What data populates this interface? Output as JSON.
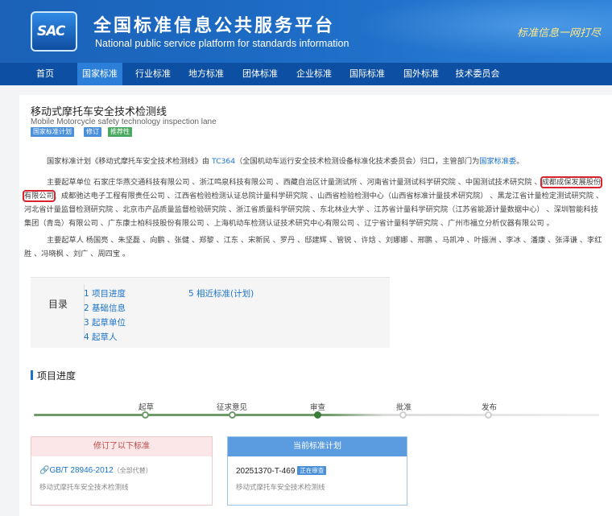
{
  "header": {
    "logo_text": "SAC",
    "title": "全国标准信息公共服务平台",
    "subtitle": "National public service platform  for standards information",
    "slogan": "标准信息一网打尽"
  },
  "nav": {
    "items": [
      "首页",
      "国家标准",
      "行业标准",
      "地方标准",
      "团体标准",
      "企业标准",
      "国际标准",
      "国外标准",
      "技术委员会"
    ],
    "active_index": 1
  },
  "standard": {
    "title": "移动式摩托车安全技术检测线",
    "title_en": "Mobile Motorcycle safety technology inspection lane",
    "tags": [
      "国家标准计划",
      "修订",
      "推荐性"
    ],
    "plan_intro": {
      "pre": "国家标准计划《移动式摩托车安全技术检测线》由",
      "tc": "TC364",
      "mid": "（全国机动车运行安全技术检测设备标准化技术委员会）归口，主管部门为",
      "dept": "国家标准委",
      "end": "。"
    },
    "drafting_units": {
      "label": "主要起草单位",
      "text_a": "石家庄华燕交通科技有限公司 、浙江鸣泉科技有限公司 、西藏自治区计量测试所 、河南省计量测试科学研究院 、中国测试技术研究院 、",
      "highlight": "成都成保发展股份有限公司",
      "text_b": "、成都驰达电子工程有限责任公司 、江西省检验检测认证总院计量科学研究院 、山西省检验检测中心（山西省标准计量技术研究院） 、黑龙江省计量检定测试研究院 、河北省计量监督检测研究院 、北京市产品质量监督检验研究院 、浙江省质量科学研究院 、东北林业大学 、江苏省计量科学研究院（江苏省能源计量数据中心） 、深圳智能科技集团（青岛）有限公司 、广东康士柏科技股份有限公司 、上海机动车检测认证技术研究中心有限公司 、辽宁省计量科学研究院 、广州市福立分析仪器有限公司 。"
    },
    "drafters": {
      "label": "主要起草人",
      "text": "杨国亮 、朱坚磊 、向鹏 、张健 、郑黎 、江东 、宋新民 、罗丹 、邸建辉 、管锐 、许焓 、刘娜娜 、邢鹏 、马凯冲 、叶振洲 、李冰 、潘康 、张泽谦 、李红胜 、冯晓枫 、刘广 、周四宝 。"
    }
  },
  "toc": {
    "title": "目录",
    "items": [
      "1 项目进度",
      "2 基础信息",
      "3 起草单位",
      "4 起草人",
      "5 相近标准(计划)"
    ]
  },
  "progress": {
    "section_title": "项目进度",
    "steps": [
      "起草",
      "征求意见",
      "审查",
      "批准",
      "发布"
    ],
    "current_step": 2
  },
  "revised": {
    "header": "修订了以下标准",
    "code": "GB/T 28946-2012",
    "note": "（全部代替）",
    "name": "移动式摩托车安全技术检测线"
  },
  "current_plan": {
    "header": "当前标准计划",
    "number": "20251370-T-469",
    "status": "正在审查",
    "name": "移动式摩托车安全技术检测线"
  },
  "colors": {
    "header_blue": "#1b62b8",
    "nav_blue": "#0d4fa3",
    "link_blue": "#1a73c8",
    "highlight_red": "#d9232d",
    "progress_green": "#6c9a68"
  }
}
